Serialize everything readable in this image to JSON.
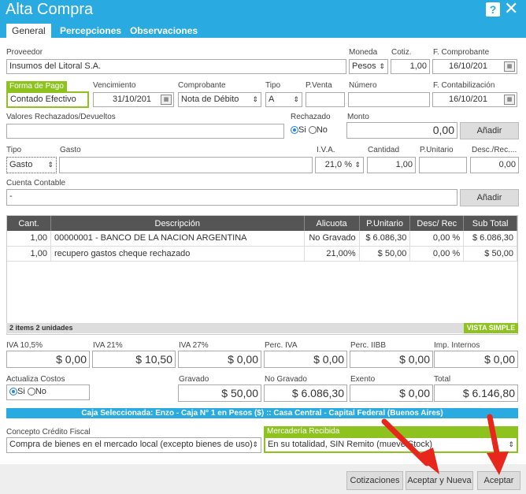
{
  "window": {
    "title": "Alta Compra"
  },
  "tabs": [
    "General",
    "Percepciones",
    "Observaciones"
  ],
  "proveedor": {
    "label": "Proveedor",
    "value": "Insumos del Litoral S.A."
  },
  "moneda": {
    "label": "Moneda",
    "value": "Pesos"
  },
  "cotiz": {
    "label": "Cotiz.",
    "value": "1,00"
  },
  "f_comprobante": {
    "label": "F. Comprobante",
    "value": "16/10/201"
  },
  "forma_pago": {
    "label": "Forma de Pago",
    "value": "Contado Efectivo"
  },
  "vencimiento": {
    "label": "Vencimiento",
    "value": "31/10/201"
  },
  "comprobante": {
    "label": "Comprobante",
    "value": "Nota de Débito"
  },
  "tipo": {
    "label": "Tipo",
    "value": "A"
  },
  "pventa": {
    "label": "P.Venta",
    "value": ""
  },
  "numero": {
    "label": "Número",
    "value": ""
  },
  "f_contabilizacion": {
    "label": "F. Contabilización",
    "value": "16/10/201"
  },
  "valores_rechazados": {
    "label": "Valores Rechazados/Devueltos",
    "value": ""
  },
  "rechazado": {
    "label": "Rechazado",
    "si": "Si",
    "no": "No"
  },
  "monto": {
    "label": "Monto",
    "value": "0,00"
  },
  "anadir1": "Añadir",
  "gasto_tipo": {
    "label": "Tipo",
    "value": "Gasto"
  },
  "gasto": {
    "label": "Gasto",
    "value": ""
  },
  "iva": {
    "label": "I.V.A.",
    "value": "21,0 %"
  },
  "cantidad": {
    "label": "Cantidad",
    "value": "1,00"
  },
  "punitario": {
    "label": "P.Unitario",
    "value": ""
  },
  "desc_rec": {
    "label": "Desc./Rec....",
    "value": "0,00"
  },
  "cuenta_contable": {
    "label": "Cuenta Contable",
    "value": "-"
  },
  "anadir2": "Añadir",
  "table": {
    "headers": [
      "Cant.",
      "Descripción",
      "Alicuota",
      "P.Unitario",
      "Desc/ Rec",
      "Sub Total"
    ],
    "rows": [
      [
        "1,00",
        "00000001 - BANCO DE LA NACION ARGENTINA",
        "No Gravado",
        "$ 6.086,30",
        "0,00 %",
        "$ 6.086,30"
      ],
      [
        "1,00",
        "recupero gastos cheque rechazado",
        "21,00%",
        "$ 50,00",
        "0,00 %",
        "$ 50,00"
      ]
    ]
  },
  "items_summary": "2 items  2 unidades",
  "vista_simple": "VISTA SIMPLE",
  "totals": {
    "iva105": {
      "label": "IVA 10,5%",
      "value": "$ 0,00"
    },
    "iva21": {
      "label": "IVA 21%",
      "value": "$ 10,50"
    },
    "iva27": {
      "label": "IVA 27%",
      "value": "$ 0,00"
    },
    "perc_iva": {
      "label": "Perc. IVA",
      "value": "$ 0,00"
    },
    "perc_iibb": {
      "label": "Perc. IIBB",
      "value": "$ 0,00"
    },
    "imp_internos": {
      "label": "Imp. Internos",
      "value": "$ 0,00"
    },
    "actualiza_costos": {
      "label": "Actualiza Costos",
      "si": "Si",
      "no": "No"
    },
    "gravado": {
      "label": "Gravado",
      "value": "$ 50,00"
    },
    "no_gravado": {
      "label": "No Gravado",
      "value": "$ 6.086,30"
    },
    "exento": {
      "label": "Exento",
      "value": "$ 0,00"
    },
    "total": {
      "label": "Total",
      "value": "$ 6.146,80"
    }
  },
  "caja": "Caja Seleccionada: Enzo - Caja N° 1 en Pesos ($) :: Casa Central - Capital Federal (Buenos Aires)",
  "concepto_credito": {
    "label": "Concepto Crédito Fiscal",
    "value": "Compra de bienes en el mercado local (excepto bienes de uso)"
  },
  "mercaderia": {
    "label": "Mercadería Recibida",
    "value": "En su totalidad, SIN Remito (mueve Stock)"
  },
  "buttons": {
    "cotizaciones": "Cotizaciones",
    "aceptar_nueva": "Aceptar y Nueva",
    "aceptar": "Aceptar"
  },
  "colors": {
    "accent": "#29abe2",
    "green": "#8dc21f",
    "arrow": "#e8271c"
  }
}
